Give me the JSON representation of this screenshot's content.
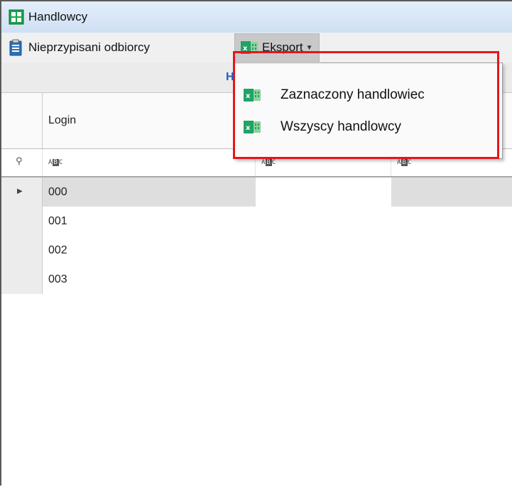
{
  "window": {
    "title": "Handlowcy",
    "icon": "grid-app-icon"
  },
  "toolbar": {
    "unassigned_label": "Nieprzypisani odbiorcy",
    "unassigned_icon": "clipboard-icon",
    "export_label": "Eksport",
    "export_icon": "excel-icon"
  },
  "export_menu": {
    "items": [
      {
        "label": "Zaznaczony handlowiec",
        "icon": "excel-icon"
      },
      {
        "label": "Wszyscy handlowcy",
        "icon": "excel-icon"
      }
    ]
  },
  "grid": {
    "group_header": "H",
    "columns": [
      "Login",
      "",
      ""
    ],
    "filter_icon": "abc-filter-icon",
    "rows": [
      {
        "login": "000",
        "selected": true
      },
      {
        "login": "001",
        "selected": false
      },
      {
        "login": "002",
        "selected": false
      },
      {
        "login": "003",
        "selected": false
      }
    ]
  },
  "colors": {
    "highlight": "#e8141c",
    "excel_green": "#21a366",
    "header_link": "#1a63c5"
  }
}
